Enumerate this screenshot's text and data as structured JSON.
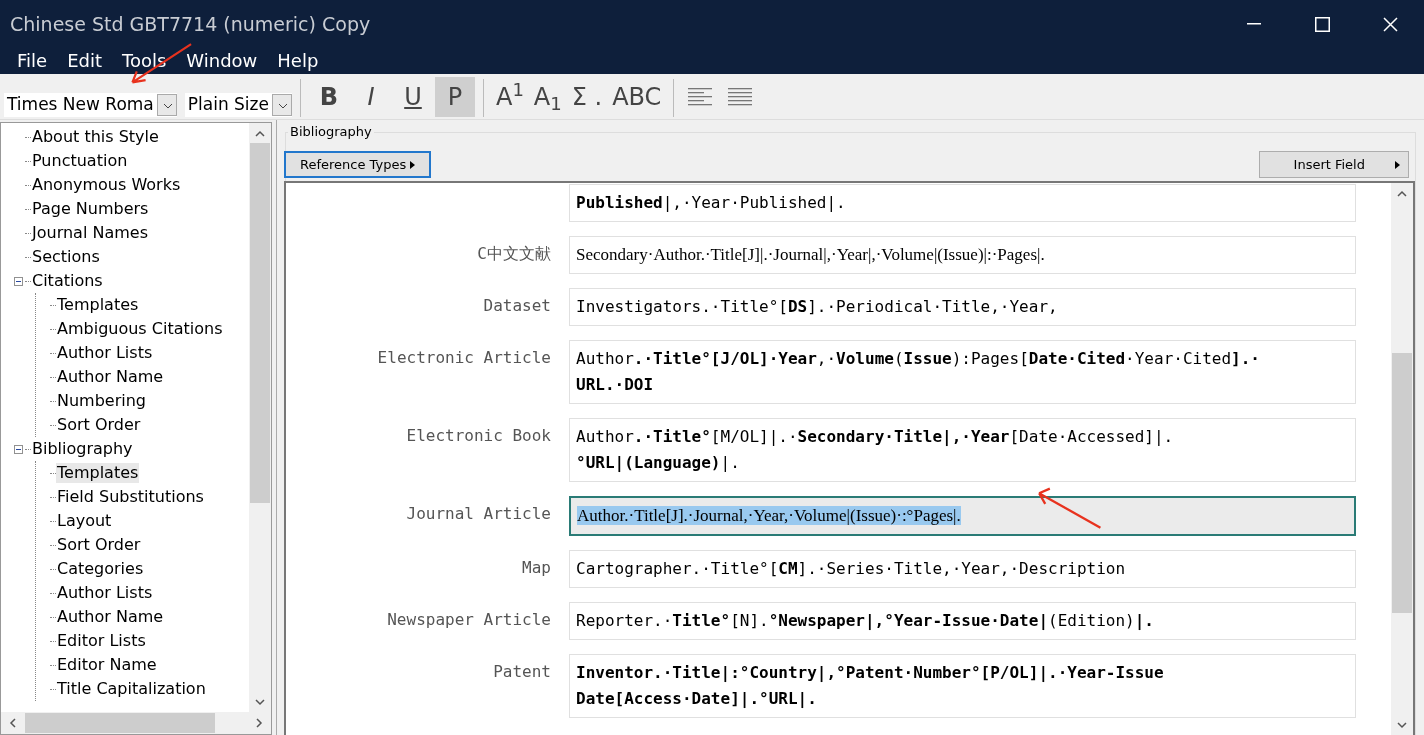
{
  "window": {
    "title": "Chinese Std GBT7714 (numeric) Copy"
  },
  "menu": [
    "File",
    "Edit",
    "Tools",
    "Window",
    "Help"
  ],
  "toolbar": {
    "font": "Times New Roma",
    "size": "Plain Size",
    "format_buttons": [
      {
        "label": "B",
        "kind": "bold",
        "selected": false
      },
      {
        "label": "I",
        "kind": "italic",
        "selected": false
      },
      {
        "label": "U",
        "kind": "underline",
        "selected": false
      },
      {
        "label": "P",
        "kind": "plain",
        "selected": true
      }
    ],
    "script_buttons": [
      {
        "label": "A$^{1}$"
      },
      {
        "label": "A$_{1}$"
      },
      {
        "label": "Σ ."
      },
      {
        "label": "ABC"
      }
    ]
  },
  "tree": [
    {
      "label": "About this Style",
      "selected": false
    },
    {
      "label": "Punctuation",
      "selected": false
    },
    {
      "label": "Anonymous Works",
      "selected": false
    },
    {
      "label": "Page Numbers",
      "selected": false
    },
    {
      "label": "Journal Names",
      "selected": false
    },
    {
      "label": "Sections",
      "selected": false
    },
    {
      "label": "Citations",
      "selected": false,
      "expanded": true,
      "children": [
        {
          "label": "Templates",
          "selected": false
        },
        {
          "label": "Ambiguous Citations",
          "selected": false
        },
        {
          "label": "Author Lists",
          "selected": false
        },
        {
          "label": "Author Name",
          "selected": false
        },
        {
          "label": "Numbering",
          "selected": false
        },
        {
          "label": "Sort Order",
          "selected": false
        }
      ]
    },
    {
      "label": "Bibliography",
      "selected": false,
      "expanded": true,
      "children": [
        {
          "label": "Templates",
          "selected": true
        },
        {
          "label": "Field Substitutions",
          "selected": false
        },
        {
          "label": "Layout",
          "selected": false
        },
        {
          "label": "Sort Order",
          "selected": false
        },
        {
          "label": "Categories",
          "selected": false
        },
        {
          "label": "Author Lists",
          "selected": false
        },
        {
          "label": "Author Name",
          "selected": false
        },
        {
          "label": "Editor Lists",
          "selected": false
        },
        {
          "label": "Editor Name",
          "selected": false
        },
        {
          "label": "Title Capitalization",
          "selected": false
        }
      ]
    }
  ],
  "panel": {
    "group_title": "Bibliography",
    "reference_types": "Reference Types",
    "insert_field": "Insert Field",
    "templates": [
      {
        "template": "**Published**|,·Year·Published|.",
        "kind": "mono",
        "selected": false
      },
      {
        "type": "C中文文献",
        "template": "Secondary·Author.·Title[J]|.·Journal|,·Year|,·Volume|(Issue)|:·Pages|.",
        "kind": "serif",
        "selected": false
      },
      {
        "type": "Dataset",
        "template": "Investigators.·Title°[**DS**].·Periodical·Title,·Year,",
        "kind": "mono",
        "selected": false
      },
      {
        "type": "Electronic Article",
        "template": "Author**.·Title°[J/OL]·Year**,·**Volume**(**Issue**):Pages[**Date·Cited**·Year·Cited**].·**\n**URL.·DOI**",
        "kind": "mono",
        "selected": false
      },
      {
        "type": "Electronic Book",
        "template": "Author**.·Title°**[M/OL]|.·**Secondary·Title|,·Year**[Date·Accessed]|.\n**°URL|(Language)**|.",
        "kind": "mono",
        "selected": false
      },
      {
        "type": "Journal Article",
        "template": "Author.·Title[J].·Journal,·Year,·Volume|(Issue)·:°Pages|.",
        "kind": "serif",
        "selected": true
      },
      {
        "type": "Map",
        "template": "Cartographer.·Title°[**CM**].·Series·Title,·Year,·Description",
        "kind": "mono",
        "selected": false
      },
      {
        "type": "Newspaper Article",
        "template": "Reporter.·**Title°**[N].**°Newspaper|,°Year-Issue·Date|**(Edition)**|.**",
        "kind": "mono",
        "selected": false
      },
      {
        "type": "Patent",
        "template": "**Inventor.·Title|:°Country|,°Patent·Number°[P/OL]|.·Year-Issue**\n**Date[Access·Date]|.°URL|.**",
        "kind": "mono",
        "selected": false
      }
    ]
  }
}
